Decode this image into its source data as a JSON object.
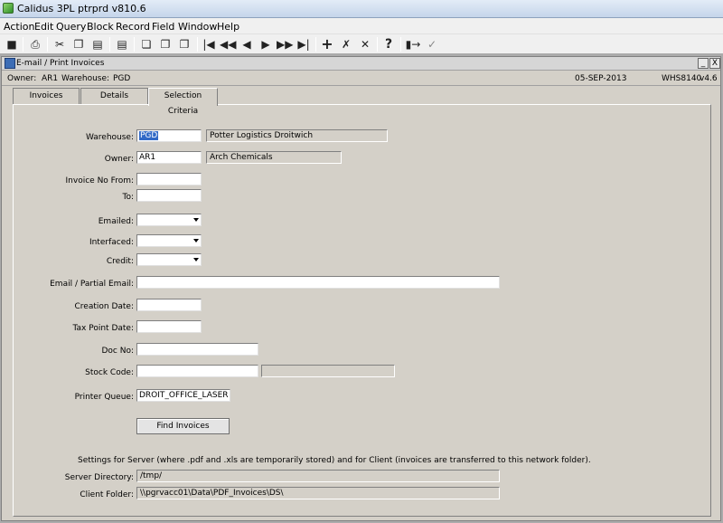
{
  "app": {
    "title": "Calidus 3PL ptrprd v810.6"
  },
  "menu": [
    "Action",
    "Edit",
    "Query",
    "Block",
    "Record",
    "Field",
    "Window",
    "Help"
  ],
  "toolbar": {
    "icons": [
      "save-icon",
      "print-icon",
      "cut-icon",
      "copy-icon",
      "paste-icon",
      "clear-icon",
      "copy-record-icon",
      "paste-record-icon",
      "duplicate-icon",
      "first-icon",
      "prev-set-icon",
      "prev-icon",
      "next-icon",
      "next-set-icon",
      "last-icon",
      "insert-icon",
      "delete-icon",
      "clear-record-icon",
      "help-icon",
      "exit-icon",
      "accept-icon"
    ]
  },
  "window": {
    "title": "E-mail / Print Invoices",
    "min_label": "_",
    "close_label": "X"
  },
  "info": {
    "owner_label": "Owner:",
    "owner": "AR1",
    "warehouse_label": "Warehouse:",
    "warehouse": "PGD",
    "date": "05-SEP-2013",
    "form_id": "WHS8140",
    "version": "v4.6"
  },
  "tabs": [
    {
      "label": "Invoices"
    },
    {
      "label": "Details"
    },
    {
      "label": "Selection Criteria"
    }
  ],
  "form": {
    "warehouse": {
      "label": "Warehouse:",
      "value": "PGD",
      "desc": "Potter Logistics Droitwich"
    },
    "owner": {
      "label": "Owner:",
      "value": "AR1",
      "desc": "Arch Chemicals"
    },
    "invoice_from": {
      "label": "Invoice No From:",
      "value": ""
    },
    "invoice_to": {
      "label": "To:",
      "value": ""
    },
    "emailed": {
      "label": "Emailed:",
      "value": ""
    },
    "interfaced": {
      "label": "Interfaced:",
      "value": ""
    },
    "credit": {
      "label": "Credit:",
      "value": ""
    },
    "email": {
      "label": "Email / Partial Email:",
      "value": ""
    },
    "creation_date": {
      "label": "Creation Date:",
      "value": ""
    },
    "tax_point_date": {
      "label": "Tax Point Date:",
      "value": ""
    },
    "doc_no": {
      "label": "Doc No:",
      "value": ""
    },
    "stock_code": {
      "label": "Stock Code:",
      "value": "",
      "desc": ""
    },
    "printer_queue": {
      "label": "Printer Queue:",
      "value": "DROIT_OFFICE_LASER"
    },
    "find_button": "Find Invoices",
    "note": "Settings for Server (where .pdf and .xls are temporarily stored) and for Client (invoices are transferred to this network folder).",
    "server_dir": {
      "label": "Server Directory:",
      "value": "/tmp/"
    },
    "client_folder": {
      "label": "Client Folder:",
      "value": "\\\\pgrvacc01\\Data\\PDF_Invoices\\DS\\"
    }
  }
}
